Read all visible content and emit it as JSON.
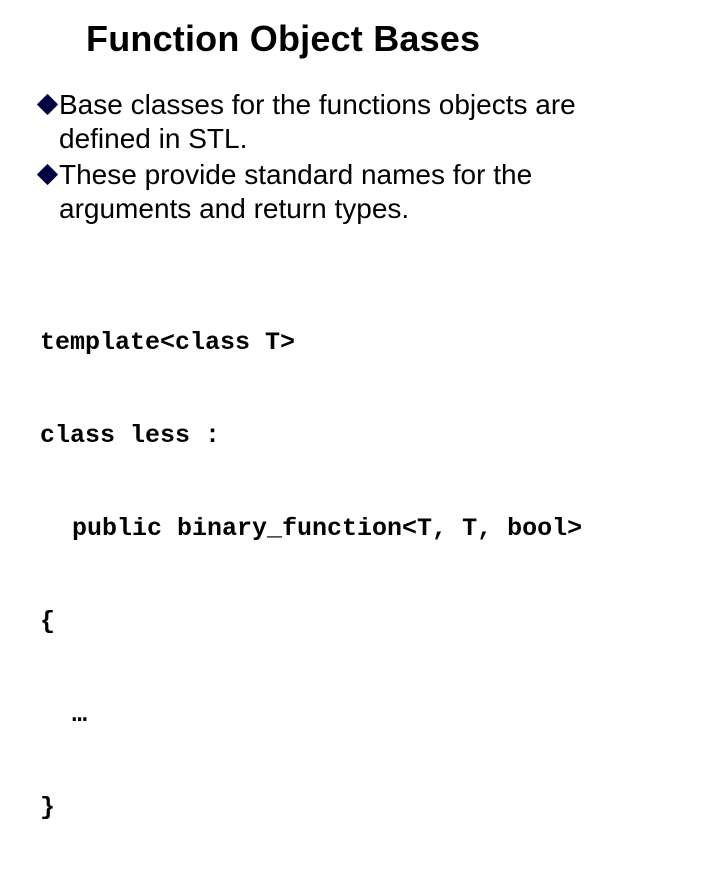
{
  "title": "Function Object Bases",
  "bullets": [
    "Base classes for the functions objects are defined in STL.",
    "These provide standard names for the arguments and return types."
  ],
  "code": {
    "l1": "template<class T>",
    "l2": "class less :",
    "l3": "public binary_function<T, T, bool>",
    "l4": "{",
    "l5": "…",
    "l6": "}"
  }
}
